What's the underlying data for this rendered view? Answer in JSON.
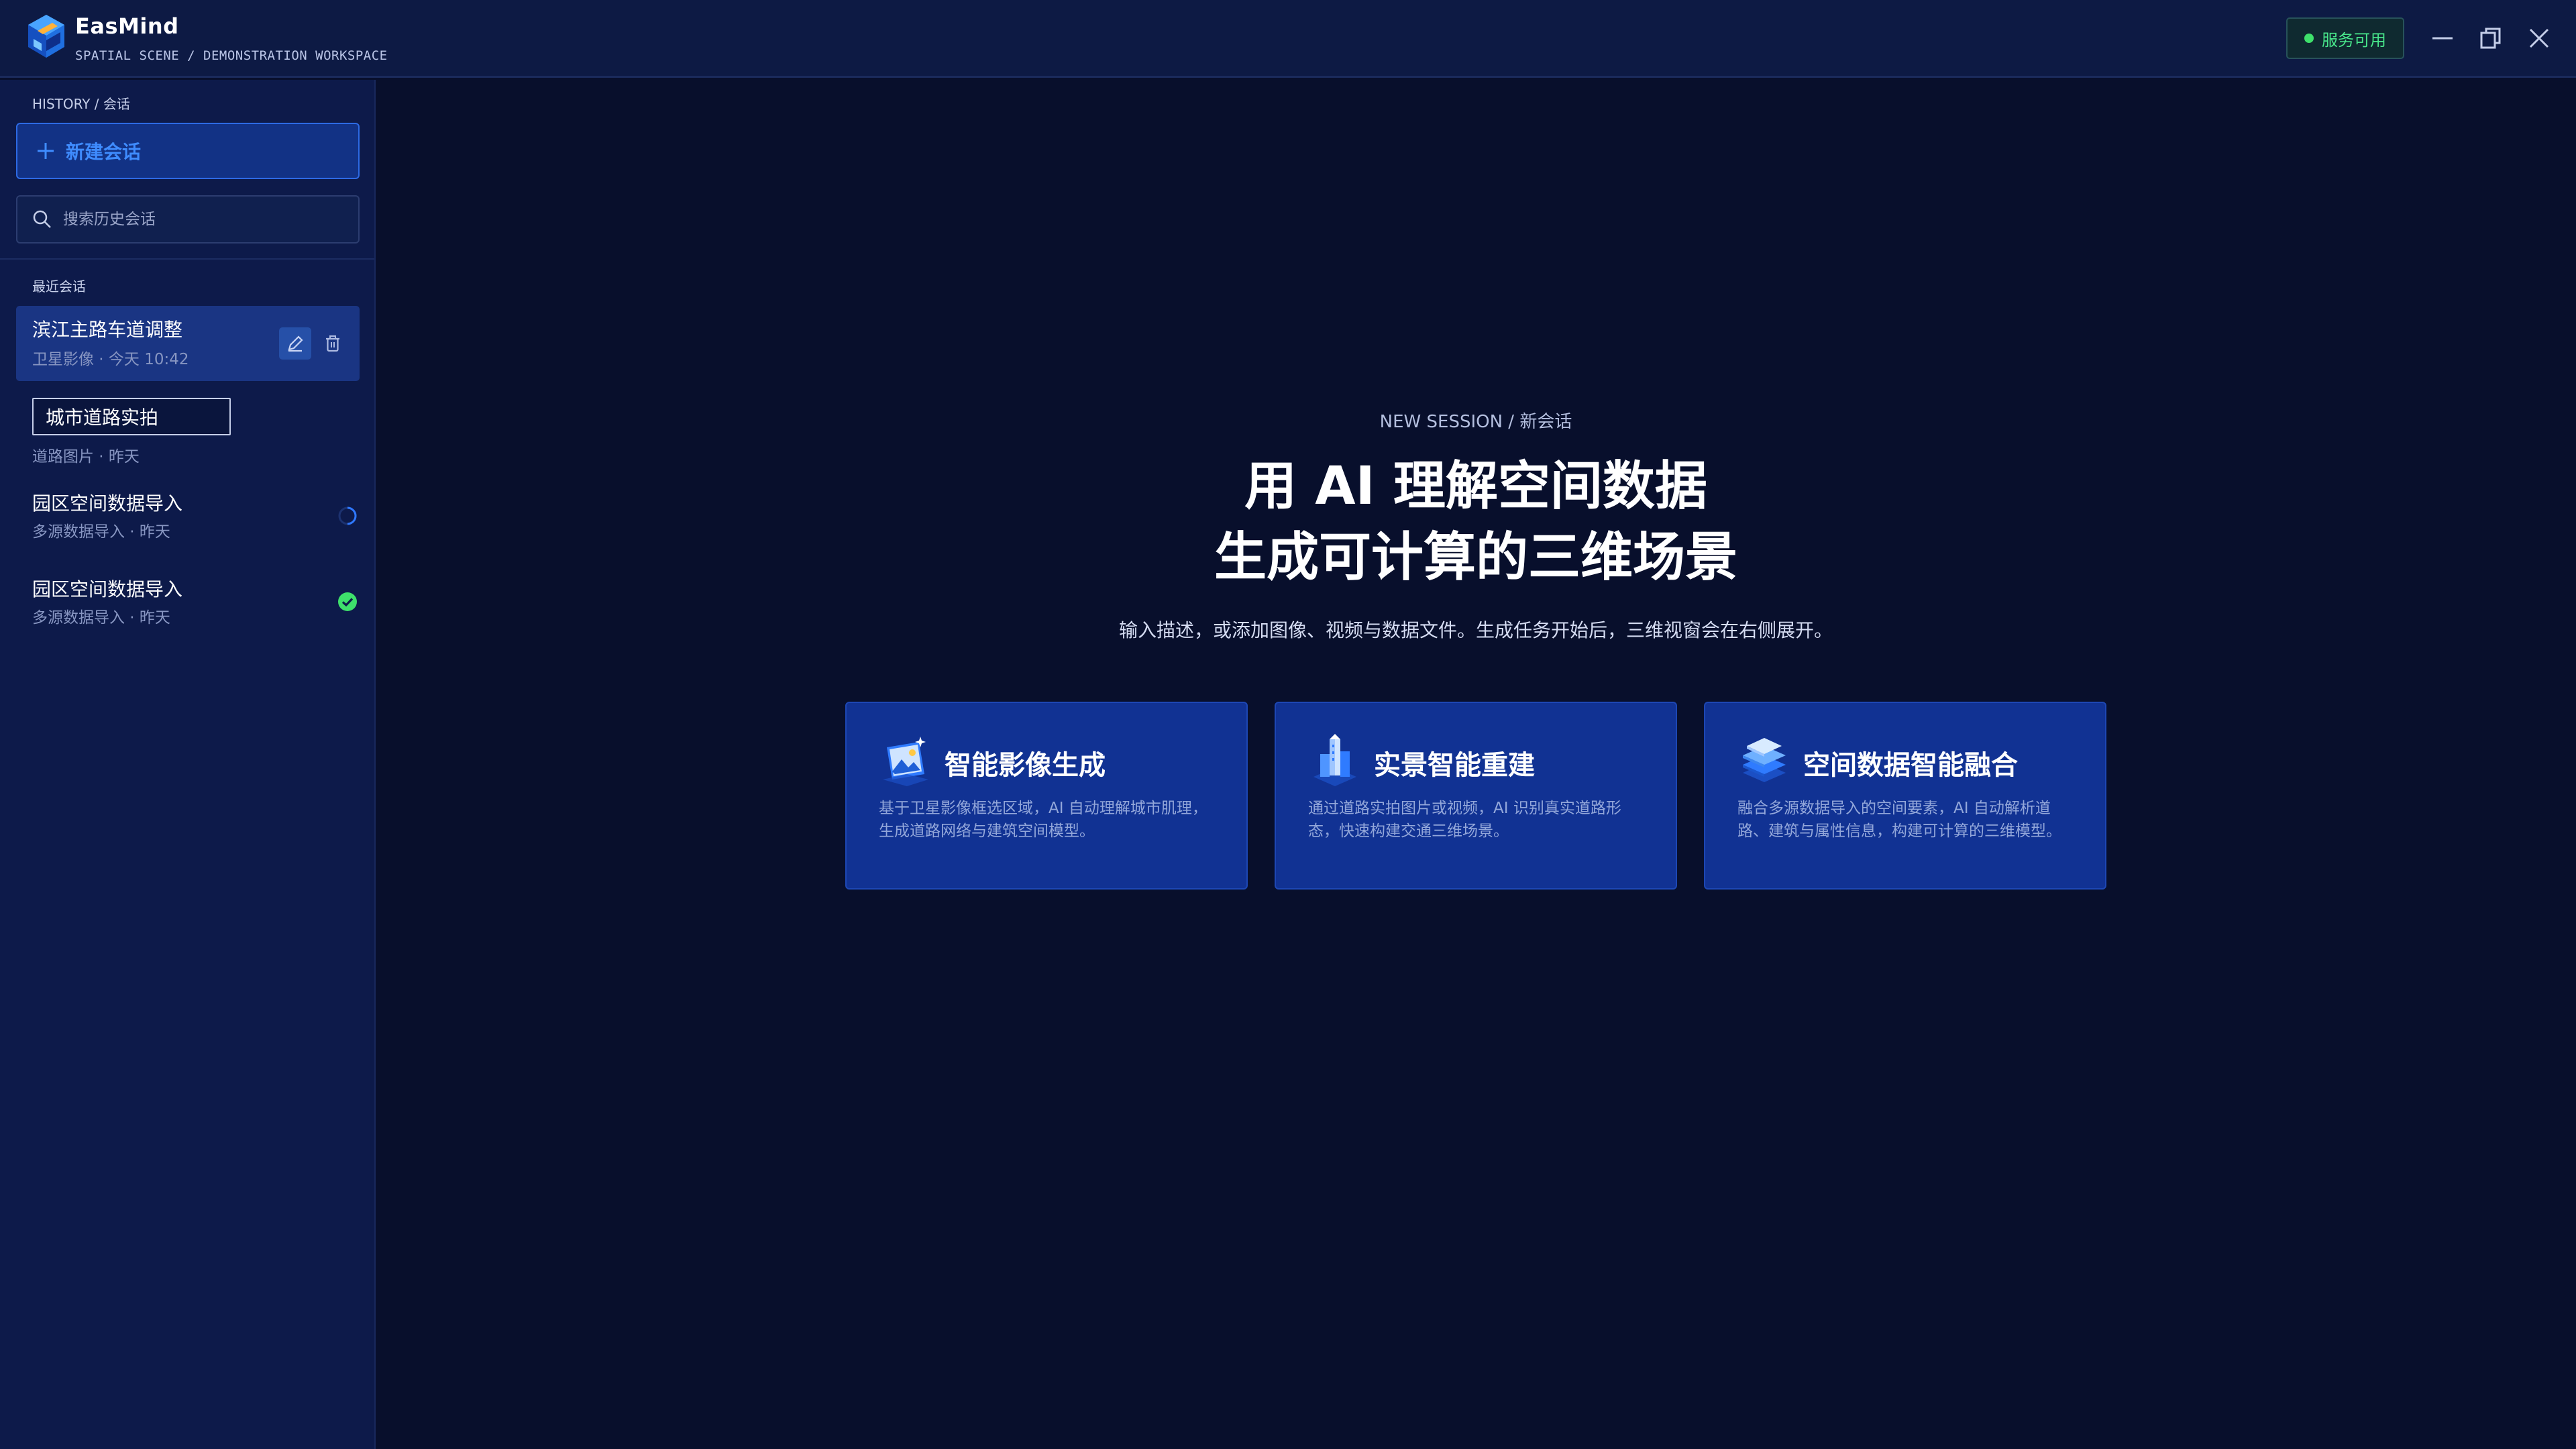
{
  "app": {
    "name": "EasMind",
    "subtitle": "SPATIAL SCENE / DEMONSTRATION WORKSPACE",
    "status": "服务可用"
  },
  "sidebar": {
    "breadcrumb": "HISTORY / 会话",
    "new_chat_label": "新建会话",
    "search_placeholder": "搜索历史会话",
    "section_label": "最近会话",
    "sessions": [
      {
        "title": "滨江主路车道调整",
        "meta": "卫星影像 · 今天 10:42",
        "state": "active"
      },
      {
        "title": "城市道路实拍",
        "meta": "道路图片 · 昨天",
        "state": "renaming"
      },
      {
        "title": "园区空间数据导入",
        "meta": "多源数据导入 · 昨天",
        "state": "processing"
      },
      {
        "title": "园区空间数据导入",
        "meta": "多源数据导入 · 昨天",
        "state": "done"
      }
    ]
  },
  "main": {
    "breadcrumb": "NEW SESSION / 新会话",
    "title_line1": "用 AI 理解空间数据",
    "title_line2": "生成可计算的三维场景",
    "subtitle": "输入描述，或添加图像、视频与数据文件。生成任务开始后，三维视窗会在右侧展开。",
    "cards": [
      {
        "icon": "image-generation-icon",
        "title": "智能影像生成",
        "desc": "基于卫星影像框选区域，AI 自动理解城市肌理，生成道路网络与建筑空间模型。"
      },
      {
        "icon": "city-reconstruction-icon",
        "title": "实景智能重建",
        "desc": "通过道路实拍图片或视频，AI 识别真实道路形态，快速构建交通三维场景。"
      },
      {
        "icon": "data-layers-icon",
        "title": "空间数据智能融合",
        "desc": "融合多源数据导入的空间要素，AI 自动解析道路、建筑与属性信息，构建可计算的三维模型。"
      }
    ]
  },
  "colors": {
    "background": "#080f2c",
    "sidebar": "#0d1a4a",
    "accent": "#3f8cff",
    "card": "#113293",
    "status_green": "#3ee06b"
  }
}
